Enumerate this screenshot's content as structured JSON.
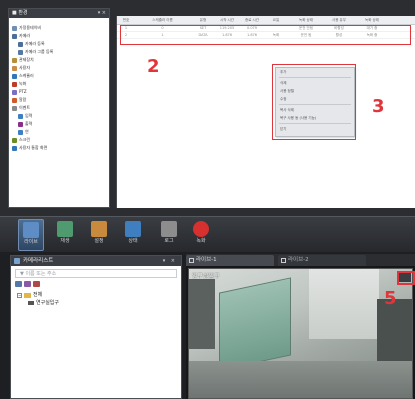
{
  "env_panel": {
    "title": "■ 환경",
    "header_controls": "▾ ×",
    "items": [
      {
        "label": "가정용테이비",
        "icon": "pc-icon",
        "cls": "ic-pc",
        "indent": 0
      },
      {
        "label": "카메라",
        "icon": "camera-icon",
        "cls": "ic-cam",
        "indent": 0
      },
      {
        "label": "카메라 등록",
        "icon": "camera-register-icon",
        "cls": "ic-cam",
        "indent": 1
      },
      {
        "label": "카메라 그룹 등록",
        "icon": "camera-group-icon",
        "cls": "ic-grp",
        "indent": 1
      },
      {
        "label": "관제장치",
        "icon": "permission-icon",
        "cls": "ic-perm",
        "indent": 0
      },
      {
        "label": "사용자",
        "icon": "user-icon",
        "cls": "ic-user",
        "indent": 0
      },
      {
        "label": "스케쥴러",
        "icon": "schedule-icon",
        "cls": "ic-sched",
        "indent": 0
      },
      {
        "label": "녹화",
        "icon": "record-icon",
        "cls": "ic-rec",
        "indent": 0
      },
      {
        "label": "PTZ",
        "icon": "ptz-icon",
        "cls": "ic-ptz",
        "indent": 0
      },
      {
        "label": "알람",
        "icon": "alarm-icon",
        "cls": "ic-alarm",
        "indent": 0
      },
      {
        "label": "이벤트",
        "icon": "event-icon",
        "cls": "ic-event",
        "indent": 0
      },
      {
        "label": "입력",
        "icon": "input-icon",
        "cls": "ic-in",
        "indent": 1
      },
      {
        "label": "출력",
        "icon": "output-icon",
        "cls": "ic-out",
        "indent": 1
      },
      {
        "label": "연",
        "icon": "link-icon",
        "cls": "ic-in",
        "indent": 1
      },
      {
        "label": "스크린",
        "icon": "screen-icon",
        "cls": "ic-scr",
        "indent": 0
      },
      {
        "label": "사용자 통합 화면",
        "icon": "user-screen-icon",
        "cls": "ic-recset",
        "indent": 0
      }
    ]
  },
  "table": {
    "columns": [
      "번호",
      "스케쥴러 이름",
      "유형",
      "시작 시간",
      "종료 시간",
      "요일",
      "녹화 상태",
      "사용 유무",
      "녹화 상태"
    ],
    "rows": [
      [
        "1",
        "0",
        "SET",
        "119.205",
        "0.079",
        "",
        "운전 안됨",
        "비활성",
        "대기 중"
      ],
      [
        "2",
        "1",
        "DATA",
        "1.876",
        "1.876",
        "녹화",
        "운전 됨",
        "활성",
        "녹화 중"
      ]
    ]
  },
  "context_menu": {
    "items": [
      "추가",
      "",
      "삭제",
      "사용 정렬",
      "수정",
      "",
      "복사 삭제",
      "복구 사용 동 (사용 기능)",
      "",
      "닫기"
    ]
  },
  "callouts": {
    "c2": "2",
    "c3": "3",
    "c5": "5"
  },
  "toolbar": {
    "buttons": [
      {
        "label": "라이브",
        "icon": "live-monitor-icon",
        "active": true
      },
      {
        "label": "재생",
        "icon": "playback-icon",
        "active": false
      },
      {
        "label": "설정",
        "icon": "settings-icon",
        "active": false
      },
      {
        "label": "상태",
        "icon": "status-icon",
        "active": false
      },
      {
        "label": "로그",
        "icon": "log-icon",
        "active": false
      },
      {
        "label": "녹화",
        "icon": "record-button-icon",
        "active": false
      }
    ]
  },
  "camera_list": {
    "title": "카메라리스트",
    "header_controls": "▾ ×",
    "search_placeholder": "이름 또는 주소",
    "root": "전체",
    "child": "연구실입구"
  },
  "live": {
    "tab_active": "라이브-1",
    "tab_inactive": "라이브-2",
    "video_label": "연구실입구"
  }
}
